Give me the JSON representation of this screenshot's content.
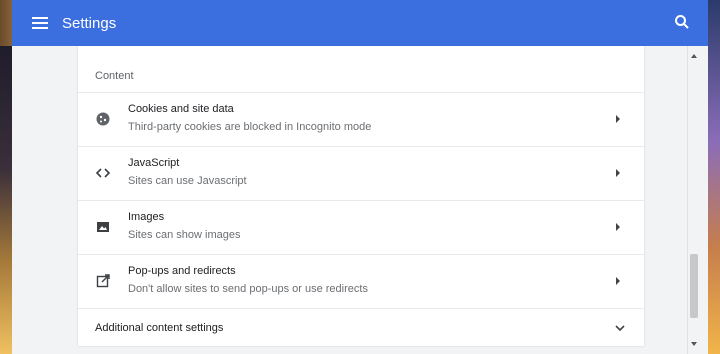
{
  "appbar": {
    "title": "Settings",
    "menu_icon": "menu-icon",
    "search_icon": "search-icon",
    "color": "#3b6fe0"
  },
  "content": {
    "section_label": "Content",
    "items": [
      {
        "icon": "cookie-icon",
        "title": "Cookies and site data",
        "subtitle": "Third-party cookies are blocked in Incognito mode"
      },
      {
        "icon": "code-icon",
        "title": "JavaScript",
        "subtitle": "Sites can use Javascript"
      },
      {
        "icon": "image-icon",
        "title": "Images",
        "subtitle": "Sites can show images"
      },
      {
        "icon": "open-in-new-icon",
        "title": "Pop-ups and redirects",
        "subtitle": "Don't allow sites to send pop-ups or use redirects"
      }
    ],
    "additional": "Additional content settings"
  }
}
